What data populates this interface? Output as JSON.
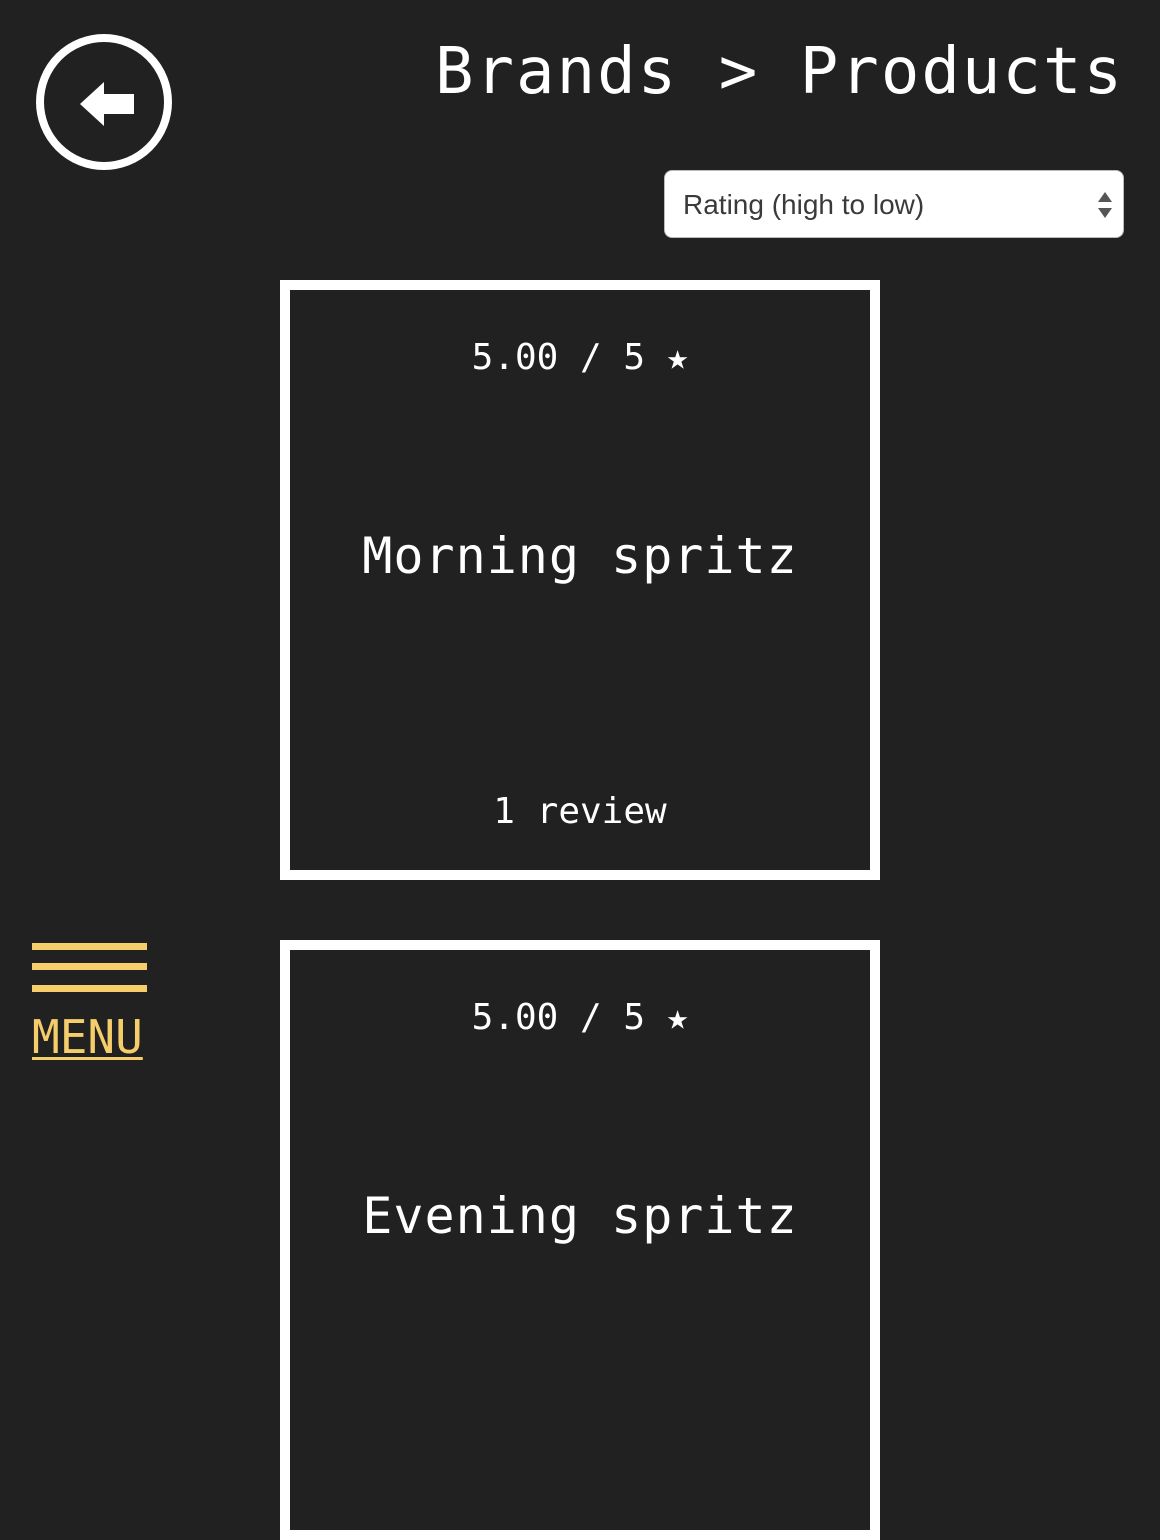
{
  "header": {
    "breadcrumb": "Brands > Products"
  },
  "icons": {
    "back": "arrow-left-icon",
    "menu": "hamburger-menu-icon",
    "sort_arrows": "sort-arrows-icon"
  },
  "sort": {
    "selected": "Rating (high to low)"
  },
  "products": [
    {
      "rating": "5.00 / 5 ★",
      "name": "Morning spritz",
      "reviews": "1 review"
    },
    {
      "rating": "5.00 / 5 ★",
      "name": "Evening spritz",
      "reviews": ""
    }
  ],
  "menu": {
    "label": "MENU"
  },
  "colors": {
    "background": "#212121",
    "foreground": "#ffffff",
    "accent": "#f5cd6a"
  }
}
